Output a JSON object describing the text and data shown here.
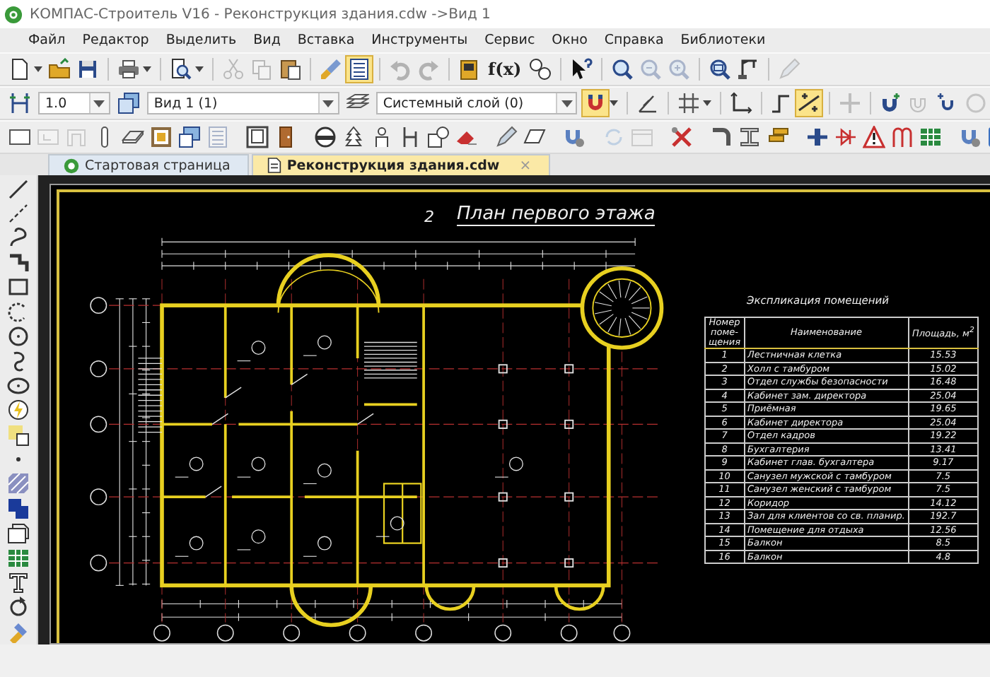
{
  "window": {
    "title": "КОМПАС-Строитель V16 - Реконструкция здания.cdw ->Вид 1"
  },
  "menu": [
    "Файл",
    "Редактор",
    "Выделить",
    "Вид",
    "Вставка",
    "Инструменты",
    "Сервис",
    "Окно",
    "Справка",
    "Библиотеки"
  ],
  "toolbar_1": [
    {
      "on": false,
      "disabled": false
    },
    {
      "on": false,
      "disabled": false
    },
    {
      "on": false,
      "disabled": false
    },
    {
      "on": false,
      "disabled": false
    },
    {
      "on": false,
      "disabled": false
    },
    {
      "on": false,
      "disabled": true
    },
    {
      "on": false,
      "disabled": true
    },
    {
      "on": false,
      "disabled": false
    },
    {
      "on": false,
      "disabled": false
    },
    {
      "on": true,
      "disabled": false
    },
    {
      "on": false,
      "disabled": true
    },
    {
      "on": false,
      "disabled": true
    },
    {
      "on": false,
      "disabled": false
    },
    {
      "on": false,
      "disabled": false
    },
    {
      "on": false,
      "disabled": false
    },
    {
      "on": false,
      "disabled": false
    },
    {
      "on": false,
      "disabled": true
    },
    {
      "on": false,
      "disabled": true
    },
    {
      "on": false,
      "disabled": false
    },
    {
      "on": false,
      "disabled": false
    },
    {
      "on": false,
      "disabled": true
    }
  ],
  "formula_button": {
    "label": "f(x)"
  },
  "property_bar": {
    "scale": "1.0",
    "view": "Вид 1 (1)",
    "layer": "Системный слой (0)"
  },
  "toolbar_2": [
    {
      "on": false,
      "disabled": false
    },
    {
      "on": false,
      "disabled": false
    },
    {
      "on": false,
      "disabled": false
    },
    {
      "on": true,
      "disabled": false
    },
    {
      "on": false,
      "disabled": false
    },
    {
      "on": false,
      "disabled": false
    },
    {
      "on": false,
      "disabled": false
    },
    {
      "on": false,
      "disabled": false
    },
    {
      "on": true,
      "disabled": false
    },
    {
      "on": false,
      "disabled": true
    },
    {
      "on": false,
      "disabled": false
    },
    {
      "on": false,
      "disabled": true
    },
    {
      "on": false,
      "disabled": false
    },
    {
      "on": false,
      "disabled": true
    }
  ],
  "toolbar_3": [
    {
      "on": false,
      "disabled": false
    },
    {
      "on": false,
      "disabled": true
    },
    {
      "on": false,
      "disabled": true
    },
    {
      "on": false,
      "disabled": false
    },
    {
      "on": false,
      "disabled": false
    },
    {
      "on": false,
      "disabled": false
    },
    {
      "on": false,
      "disabled": false
    },
    {
      "on": false,
      "disabled": true
    },
    {
      "on": false,
      "disabled": false
    },
    {
      "on": false,
      "disabled": false
    },
    {
      "on": false,
      "disabled": false
    },
    {
      "on": false,
      "disabled": false
    },
    {
      "on": false,
      "disabled": false
    },
    {
      "on": false,
      "disabled": false
    },
    {
      "on": false,
      "disabled": false
    },
    {
      "on": false,
      "disabled": false
    },
    {
      "on": false,
      "disabled": false
    },
    {
      "on": false,
      "disabled": false
    },
    {
      "on": false,
      "disabled": false
    },
    {
      "on": false,
      "disabled": true
    },
    {
      "on": false,
      "disabled": true
    },
    {
      "on": false,
      "disabled": false
    },
    {
      "on": false,
      "disabled": false
    },
    {
      "on": false,
      "disabled": false
    },
    {
      "on": false,
      "disabled": false
    },
    {
      "on": false,
      "disabled": false
    },
    {
      "on": false,
      "disabled": false
    },
    {
      "on": false,
      "disabled": false
    },
    {
      "on": false,
      "disabled": false
    },
    {
      "on": false,
      "disabled": false
    },
    {
      "on": false,
      "disabled": false
    },
    {
      "on": false,
      "disabled": false
    }
  ],
  "tabs": [
    {
      "label": "Стартовая страница",
      "selected": false
    },
    {
      "label": "Реконструкция здания.cdw",
      "selected": true,
      "close": "×"
    }
  ],
  "drawing": {
    "sheet_number": "2",
    "title": "План первого этажа"
  },
  "explication": {
    "title": "Экспликация помещений",
    "columns": [
      "Номер поме- щения",
      "Наименование",
      "Площадь, м$^{2}$"
    ],
    "rows": [
      [
        "1",
        "Лестничная клетка",
        "15.53"
      ],
      [
        "2",
        "Холл с тамбуром",
        "15.02"
      ],
      [
        "3",
        "Отдел службы безопасности",
        "16.48"
      ],
      [
        "4",
        "Кабинет зам. директора",
        "25.04"
      ],
      [
        "5",
        "Приёмная",
        "19.65"
      ],
      [
        "6",
        "Кабинет директора",
        "25.04"
      ],
      [
        "7",
        "Отдел кадров",
        "19.22"
      ],
      [
        "8",
        "Бухгалтерия",
        "13.41"
      ],
      [
        "9",
        "Кабинет глав. бухгалтера",
        "9.17"
      ],
      [
        "10",
        "Санузел мужской с тамбуром",
        "7.5"
      ],
      [
        "11",
        "Санузел женский с тамбуром",
        "7.5"
      ],
      [
        "12",
        "Коридор",
        "14.12"
      ],
      [
        "13",
        "Зал для клиентов со св. планир.",
        "192.7"
      ],
      [
        "14",
        "Помещение для отдыха",
        "12.56"
      ],
      [
        "15",
        "Балкон",
        "8.5"
      ],
      [
        "16",
        "Балкон",
        "4.8"
      ]
    ]
  }
}
